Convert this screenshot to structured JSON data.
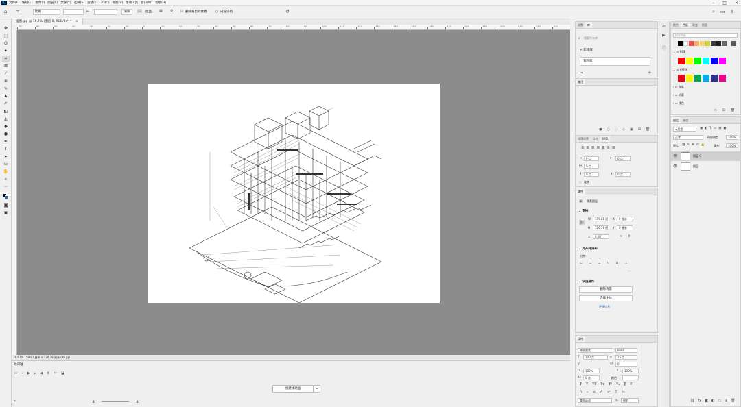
{
  "menu": {
    "app_logo": "Ps",
    "items": [
      "文件(F)",
      "编辑(E)",
      "图像(I)",
      "图层(L)",
      "文字(Y)",
      "选择(S)",
      "滤镜(T)",
      "3D(D)",
      "视图(V)",
      "增效工具",
      "窗口(W)",
      "帮助(H)"
    ]
  },
  "options": {
    "ratio_label": "比例",
    "clear_label": "清除",
    "straighten_label": "拉直",
    "delete_cropped_label": "删除裁剪的像素",
    "content_aware_label": "内容识别"
  },
  "document": {
    "tab_title": "插图.jpg @ 16.7% (图层 0, RGB/8#) *",
    "status": "16.67%    159.81 厘米 x 120.78 厘米 (96 ppi)",
    "ruler_ticks": [
      "70",
      "60",
      "50",
      "40",
      "30",
      "20",
      "10",
      "0",
      "10",
      "20",
      "30",
      "40",
      "50",
      "60",
      "70",
      "80",
      "90",
      "100",
      "110",
      "120",
      "130",
      "140",
      "150",
      "160",
      "170",
      "180",
      "190",
      "200",
      "210",
      "220",
      "230"
    ]
  },
  "timeline": {
    "title": "时间轴",
    "create_button": "创建帧动画"
  },
  "history_panel": {
    "tabs": [
      "调整",
      "库"
    ],
    "search_placeholder": "搜索所有库",
    "new_library": "新建库",
    "my_library": "我的库"
  },
  "color_panel": {
    "tabs": [
      "颜色",
      "色板",
      "渐变",
      "图案"
    ],
    "search_placeholder": "搜索色板",
    "groups": [
      "RGB",
      "CMYK",
      "灰度",
      "粉彩",
      "浅色"
    ],
    "colors": {
      "red": "#ff0000",
      "yellow": "#ffff00",
      "green": "#00ff00",
      "cyan": "#00ffff",
      "blue": "#0000ff",
      "magenta": "#ff00ff",
      "cmyk_red": "#e8001c",
      "cmyk_yellow": "#fff200",
      "cmyk_green": "#00a651",
      "cmyk_cyan": "#00aeef",
      "cmyk_blue": "#2e3192",
      "cmyk_magenta": "#ec008c"
    }
  },
  "paths_panel": {
    "title": "路径"
  },
  "paragraph_panel": {
    "tabs": [
      "段落设置",
      "字符",
      "段落"
    ],
    "indent_left": "0 点",
    "indent_right": "0 点",
    "indent_first": "0 点",
    "space_before": "0 点",
    "space_after": "0 点",
    "hyphenate": "连字"
  },
  "properties_panel": {
    "title": "属性",
    "layer_type": "像素图层",
    "transform": "变换",
    "w": "159.81 厘",
    "x": "0 厘米",
    "h": "120.78 厘",
    "y": "0 厘米",
    "angle": "0.00°",
    "align_heading": "对齐并分布",
    "align_label": "对齐:",
    "quick_actions": "快速操作",
    "remove_bg": "删除背景",
    "select_subject": "选择主体",
    "more": "更多信息"
  },
  "character_panel": {
    "title": "字符",
    "font": "微软雅黑",
    "style": "Bold",
    "size": "100 点",
    "leading": "15 点",
    "tracking": "0",
    "vscale": "100%",
    "hscale": "100%",
    "baseline": "0 点",
    "color_label": "颜色:",
    "language": "美国英语",
    "aa": "锐利"
  },
  "layers_panel": {
    "tabs": [
      "图层",
      "通道"
    ],
    "filter": "类型",
    "blend": "正常",
    "opacity_label": "不透明度:",
    "opacity": "100%",
    "lock_label": "锁定:",
    "fill_label": "填充:",
    "fill": "100%",
    "layers": [
      "图层 0",
      "图层"
    ]
  }
}
